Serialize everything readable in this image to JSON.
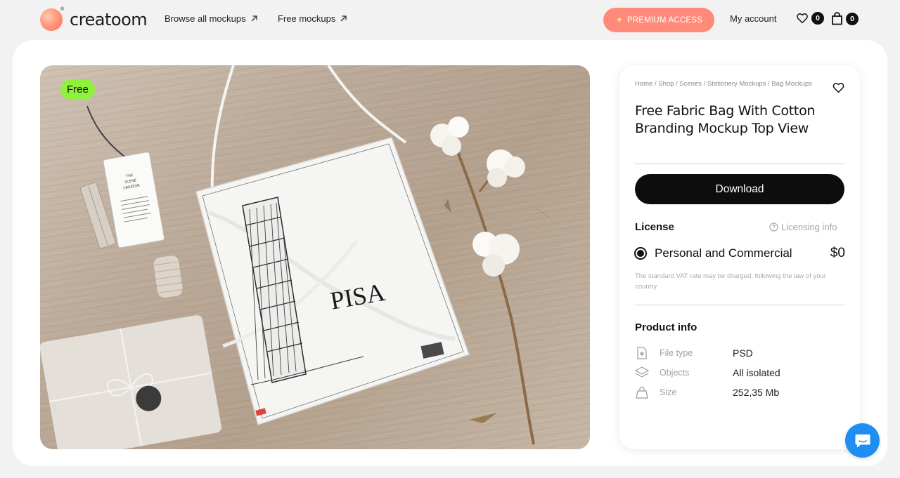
{
  "header": {
    "logo_text": "creatoom",
    "logo_mark": "®",
    "nav": [
      {
        "label": "Browse all mockups",
        "icon": "arrow-up-right-icon"
      },
      {
        "label": "Free mockups",
        "icon": "arrow-up-right-icon"
      }
    ],
    "premium_label": "PREMIUM ACCESS",
    "account_label": "My account",
    "wishlist_count": "0",
    "cart_count": "0"
  },
  "colors": {
    "accent": "#ff8a7a",
    "free_badge": "#8ff23a",
    "chat": "#1e8ff0",
    "button": "#0d0d0d"
  },
  "product": {
    "badge": "Free",
    "breadcrumb": "Home / Shop / Scenes / Stationery Mockups / Bag Mockups",
    "title": "Free Fabric Bag With Cotton Branding Mockup Top View",
    "download_label": "Download",
    "license_heading": "License",
    "licensing_info_label": "Licensing info",
    "license_option": "Personal and Commercial",
    "price": "$0",
    "vat_note": "The standard VAT rate may be charged, following the law of your country",
    "product_info_heading": "Product info",
    "info": [
      {
        "label": "File type",
        "value": "PSD",
        "icon": "file-icon"
      },
      {
        "label": "Objects",
        "value": "All isolated",
        "icon": "layers-icon"
      },
      {
        "label": "Size",
        "value": "252,35 Mb",
        "icon": "bag-icon"
      }
    ]
  },
  "image": {
    "bag_text": "PISA",
    "tag_text": [
      "THE",
      "SCENE",
      "CREATOR"
    ]
  }
}
